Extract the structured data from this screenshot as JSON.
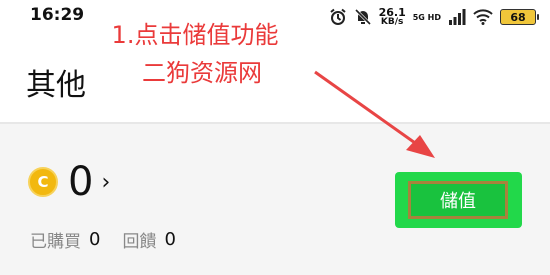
{
  "status_bar": {
    "time": "16:29",
    "net_speed_value": "26.1",
    "net_speed_unit": "KB/s",
    "signal_label_top": "5G HD",
    "signal_label_bottom": "",
    "battery_level": "68"
  },
  "page": {
    "title": "其他"
  },
  "annotation": {
    "line1": "1.点击储值功能",
    "line2": "二狗资源网",
    "color": "#ea3a3a"
  },
  "wallet": {
    "coin_symbol": "C",
    "balance": "0",
    "chevron": "›",
    "purchased_label": "已購買",
    "purchased_value": "0",
    "feedback_label": "回饋",
    "feedback_value": "0",
    "deposit_label": "儲值"
  }
}
